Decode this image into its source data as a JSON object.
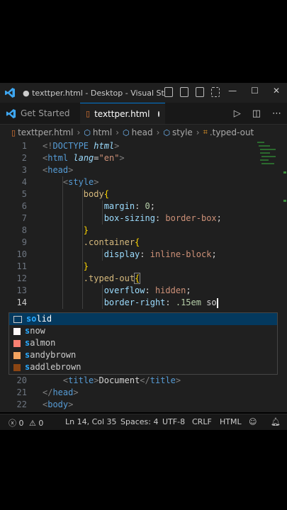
{
  "window": {
    "title": "● texttper.html - Desktop - Visual Studi..."
  },
  "tabs": [
    {
      "label": "Get Started",
      "active": false
    },
    {
      "label": "texttper.html",
      "active": true,
      "dirty": true
    }
  ],
  "breadcrumb": [
    "texttper.html",
    "html",
    "head",
    "style",
    ".typed-out"
  ],
  "editor": {
    "current_line": 14,
    "line_numbers": [
      "1",
      "2",
      "3",
      "4",
      "5",
      "6",
      "7",
      "8",
      "9",
      "10",
      "11",
      "12",
      "13",
      "14",
      "20",
      "21",
      "22"
    ]
  },
  "suggestions": [
    {
      "label": "solid",
      "match": "so",
      "kind": "keyword",
      "color": ""
    },
    {
      "label": "snow",
      "match": "s",
      "kind": "color",
      "color": "#fffafa"
    },
    {
      "label": "salmon",
      "match": "s",
      "kind": "color",
      "color": "#fa8072"
    },
    {
      "label": "sandybrown",
      "match": "s",
      "kind": "color",
      "color": "#f4a460"
    },
    {
      "label": "saddlebrown",
      "match": "s",
      "kind": "color",
      "color": "#8b4513"
    }
  ],
  "statusbar": {
    "errors": "0",
    "warnings": "0",
    "position": "Ln 14, Col 35",
    "spaces": "Spaces: 4",
    "encoding": "UTF-8",
    "eol": "CRLF",
    "language": "HTML"
  },
  "colors": {
    "accent": "#0078d4",
    "vscode_blue": "#3ea6f0",
    "editor_bg": "#1f1f1f"
  }
}
